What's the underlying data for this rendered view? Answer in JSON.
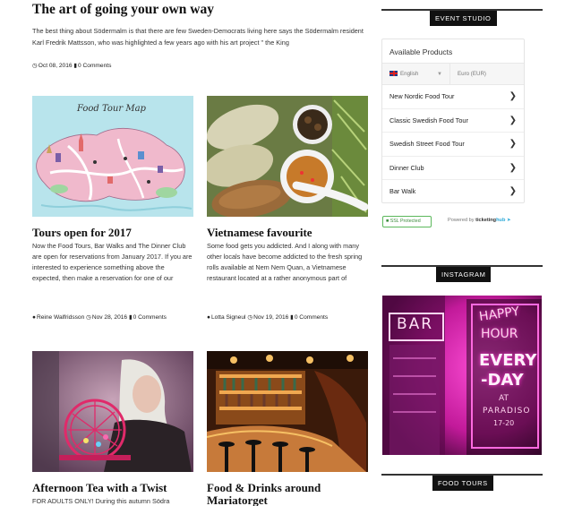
{
  "featured": {
    "title": "The art of going your own way",
    "excerpt": "The best thing about Södermalm is that there are few Sweden-Democrats living here says the Södermalm resident Karl Fredrik Mattsson, who was highlighted a few years ago with his art project \" the King",
    "date": "Oct 08, 2016",
    "comments": "0 Comments"
  },
  "cards": [
    {
      "title": "Tours open for 2017",
      "image_text": "Food Tour Map",
      "excerpt": "Now the Food Tours, Bar Walks and The Dinner Club are open for reservations from January 2017. If you are interested to experience something above the expected, then make a reservation for one of our",
      "author": "Reine Walfridsson",
      "date": "Nov 28, 2016",
      "comments": "0 Comments"
    },
    {
      "title": "Vietnamese favourite",
      "excerpt": "Some food gets you addicted. And I along with many other locals have become addicted to the fresh spring rolls available at Nem Nem Quan, a Vietnamese restaurant located at a rather anonymous part of",
      "author": "Lotta Signeul",
      "date": "Nov 19, 2016",
      "comments": "0 Comments"
    },
    {
      "title": "Afternoon Tea with a Twist",
      "excerpt": "FOR ADULTS ONLY! During this autumn Södra"
    },
    {
      "title": "Food & Drinks around Mariatorget"
    }
  ],
  "sidebar": {
    "event_label": "EVENT STUDIO",
    "widget": {
      "heading": "Available Products",
      "language": "English",
      "currency": "Euro (EUR)",
      "products": [
        "New Nordic Food Tour",
        "Classic Swedish Food Tour",
        "Swedish Street Food Tour",
        "Dinner Club",
        "Bar Walk"
      ]
    },
    "ssl_text": "SSL Protected",
    "powered_prefix": "Powered by ",
    "powered_brand": "ticketing",
    "powered_brand_b": "hub",
    "instagram_label": "INSTAGRAM",
    "neon": {
      "bar": "BAR",
      "line1": "HAPPY",
      "line2": "HOUR",
      "line3": "EVERY",
      "line4": "-DAY",
      "at": "AT",
      "place": "PARADISO",
      "hours": "17-20"
    },
    "foodtours_label": "FOOD TOURS"
  },
  "colors": {
    "accent_green": "#5cb85c",
    "label_bg": "#111111",
    "neon_pink": "#ff3fd0"
  }
}
